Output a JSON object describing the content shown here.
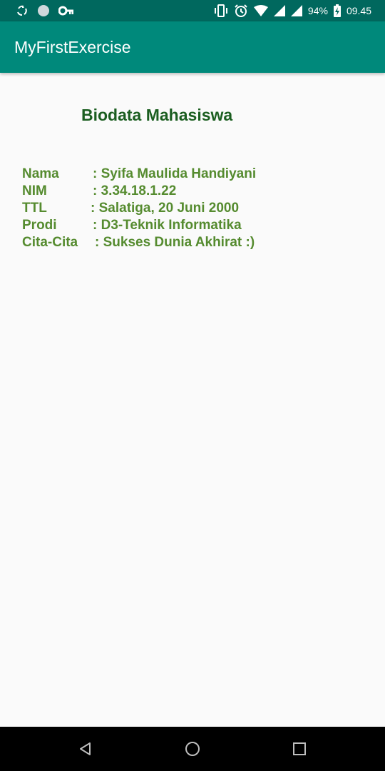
{
  "status_bar": {
    "battery_percent": "94%",
    "time": "09.45",
    "left_icons": [
      "sync-icon",
      "circle-icon",
      "key-icon"
    ],
    "right_icons": [
      "vibrate-icon",
      "alarm-icon",
      "wifi-icon",
      "signal-icon",
      "signal-icon",
      "battery-charging-icon"
    ]
  },
  "app_bar": {
    "title": "MyFirstExercise",
    "color": "#00897b"
  },
  "content": {
    "heading": "Biodata Mahasiswa",
    "rows": [
      {
        "label": "Nama",
        "value": ": Syifa Maulida Handiyani"
      },
      {
        "label": "NIM",
        "value": ": 3.34.18.1.22"
      },
      {
        "label": "TTL",
        "value": ": Salatiga, 20 Juni 2000"
      },
      {
        "label": "Prodi",
        "value": ": D3-Teknik Informatika"
      },
      {
        "label": "Cita-Cita",
        "value": ": Sukses Dunia Akhirat :)"
      }
    ],
    "heading_color": "#1b5e20",
    "text_color": "#558b2f"
  },
  "nav_bar": {
    "buttons": [
      "back-icon",
      "home-icon",
      "recents-icon"
    ]
  }
}
